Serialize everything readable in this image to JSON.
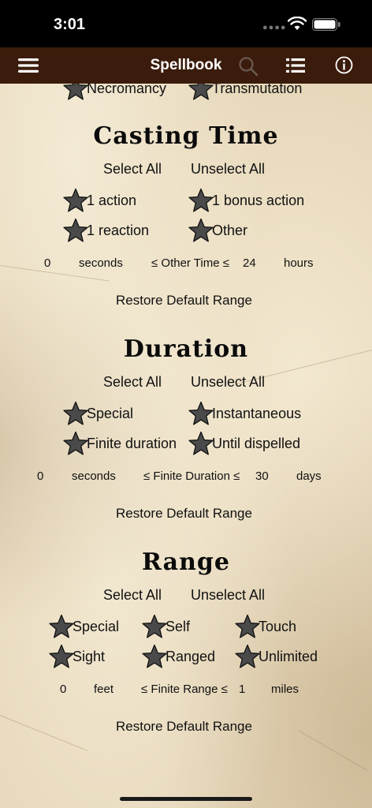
{
  "status": {
    "time": "3:01"
  },
  "nav": {
    "title": "Spellbook"
  },
  "schools_tail": {
    "left": "Necromancy",
    "right": "Transmutation"
  },
  "casting": {
    "title": "Casting Time",
    "select_all": "Select All",
    "unselect_all": "Unselect All",
    "options": [
      "1 action",
      "1 bonus action",
      "1 reaction",
      "Other"
    ],
    "min_value": "0",
    "min_unit": "seconds",
    "range_label": "≤ Other Time ≤",
    "max_value": "24",
    "max_unit": "hours",
    "restore": "Restore Default Range"
  },
  "duration": {
    "title": "Duration",
    "select_all": "Select All",
    "unselect_all": "Unselect All",
    "options": [
      "Special",
      "Instantaneous",
      "Finite duration",
      "Until dispelled"
    ],
    "min_value": "0",
    "min_unit": "seconds",
    "range_label": "≤ Finite Duration ≤",
    "max_value": "30",
    "max_unit": "days",
    "restore": "Restore Default Range"
  },
  "range": {
    "title": "Range",
    "select_all": "Select All",
    "unselect_all": "Unselect All",
    "options": [
      "Special",
      "Self",
      "Touch",
      "Sight",
      "Ranged",
      "Unlimited"
    ],
    "min_value": "0",
    "min_unit": "feet",
    "range_label": "≤ Finite Range ≤",
    "max_value": "1",
    "max_unit": "miles",
    "restore": "Restore Default Range"
  },
  "colors": {
    "nav_bg": "#3b1c0c",
    "star_fill": "#4a4a4a",
    "parchment": "#e6d7b9"
  }
}
